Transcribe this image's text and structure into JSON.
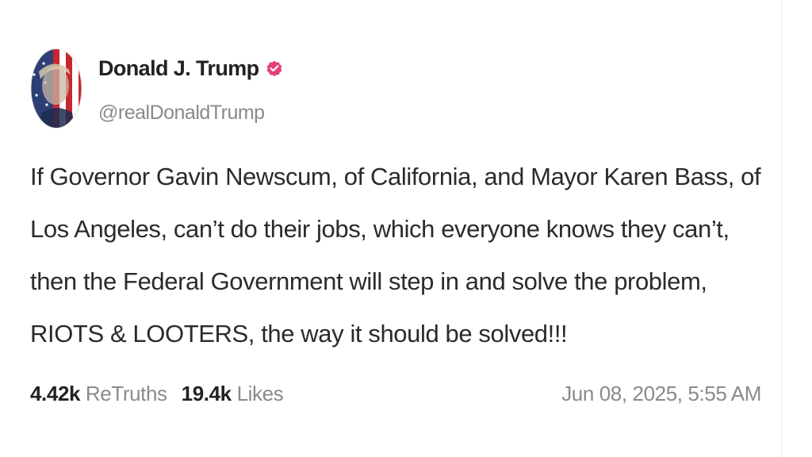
{
  "post": {
    "author": {
      "display_name": "Donald J. Trump",
      "handle": "@realDonaldTrump",
      "verified": true,
      "verified_icon": "verified-badge-icon",
      "verified_color": "#e63e79"
    },
    "body": "If Governor Gavin Newscum, of California, and Mayor Karen Bass, of Los Angeles, can’t do their jobs, which everyone knows they can’t, then the Federal Government will step in and solve the problem, RIOTS & LOOTERS, the way it should be solved!!!",
    "stats": {
      "retruths_count": "4.42k",
      "retruths_label": "ReTruths",
      "likes_count": "19.4k",
      "likes_label": "Likes"
    },
    "timestamp": "Jun 08, 2025, 5:55 AM"
  }
}
